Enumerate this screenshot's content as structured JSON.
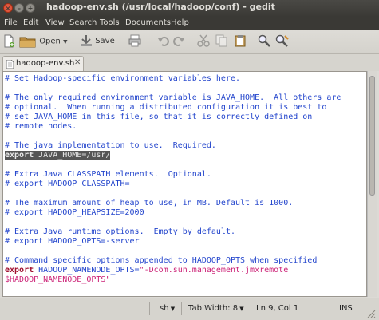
{
  "window": {
    "title": "hadoop-env.sh (/usr/local/hadoop/conf) - gedit"
  },
  "menu": [
    "File",
    "Edit",
    "View",
    "Search",
    "Tools",
    "Documents",
    "Help"
  ],
  "toolbar": {
    "open_label": "Open",
    "save_label": "Save"
  },
  "tab": {
    "label": "hadoop-env.sh",
    "close_glyph": "✕"
  },
  "editor": {
    "lines": [
      "# Set Hadoop-specific environment variables here.",
      "",
      "# The only required environment variable is JAVA_HOME.  All others are",
      "# optional.  When running a distributed configuration it is best to",
      "# set JAVA_HOME in this file, so that it is correctly defined on",
      "# remote nodes.",
      "",
      "# The java implementation to use.  Required.",
      "",
      "",
      "# Extra Java CLASSPATH elements.  Optional.",
      "# export HADOOP_CLASSPATH=",
      "",
      "# The maximum amount of heap to use, in MB. Default is 1000.",
      "# export HADOOP_HEAPSIZE=2000",
      "",
      "# Extra Java runtime options.  Empty by default.",
      "# export HADOOP_OPTS=-server",
      "",
      "# Command specific options appended to HADOOP_OPTS when specified",
      "",
      "$HADOOP_NAMENODE_OPTS\""
    ],
    "java_home_line": {
      "keyword": "export",
      "rest": " JAVA_HOME=/usr/"
    },
    "namenode_line": {
      "keyword": "export",
      "var": " HADOOP_NAMENODE_OPTS=",
      "value": "\"-Dcom.sun.management.jmxremote"
    }
  },
  "status": {
    "language": "sh",
    "tab_width": "Tab Width: 8",
    "position": "Ln 9, Col 1",
    "mode": "INS"
  },
  "colors": {
    "comment": "#2244cc",
    "keyword": "#a01030",
    "string": "#cc2277",
    "selection": "#555555"
  }
}
